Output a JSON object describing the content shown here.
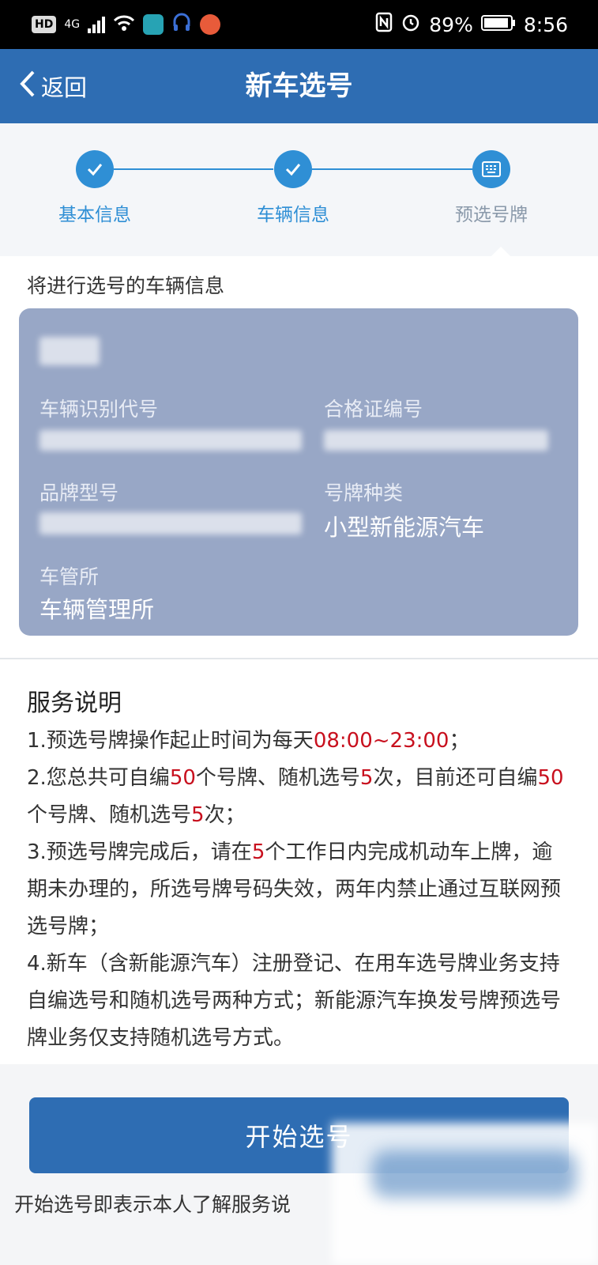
{
  "status_bar": {
    "badge": "HD",
    "network": "4G",
    "battery": "89%",
    "time": "8:56",
    "colors": {
      "app_teal": "#27a3b4",
      "app_orange": "#e85b3a",
      "app_blue": "#3b6fd6"
    }
  },
  "header": {
    "back_label": "返回",
    "title": "新车选号",
    "color": "#2e6db3"
  },
  "steps": [
    {
      "label": "基本信息",
      "state": "done",
      "icon": "check-icon"
    },
    {
      "label": "车辆信息",
      "state": "done",
      "icon": "check-icon"
    },
    {
      "label": "预选号牌",
      "state": "current",
      "icon": "keyboard-icon"
    }
  ],
  "vehicle": {
    "heading": "将进行选号的车辆信息",
    "vin_label": "车辆识别代号",
    "cert_label": "合格证编号",
    "model_label": "品牌型号",
    "plate_type_label": "号牌种类",
    "plate_type_value": "小型新能源汽车",
    "office_label": "车管所",
    "office_value": "车辆管理所"
  },
  "service": {
    "title": "服务说明",
    "item1_a": "1.预选号牌操作起止时间为每天",
    "item1_time": "08:00~23:00",
    "item1_b": "；",
    "item2_a": "2.您总共可自编",
    "item2_n1": "50",
    "item2_b": "个号牌、随机选号",
    "item2_n2": "5",
    "item2_c": "次，目前还可自编",
    "item2_n3": "50",
    "item2_d": "个号牌、随机选号",
    "item2_n4": "5",
    "item2_e": "次；",
    "item3_a": "3.预选号牌完成后，请在",
    "item3_n": "5",
    "item3_b": "个工作日内完成机动车上牌，逾期未办理的，所选号牌号码失效，两年内禁止通过互联网预选号牌；",
    "item4": "4.新车（含新能源汽车）注册登记、在用车选号牌业务支持自编选号和随机选号两种方式；新能源汽车换发号牌预选号牌业务仅支持随机选号方式。",
    "highlight_color": "#c8101e"
  },
  "start_button_label": "开始选号",
  "footer_note": "开始选号即表示本人了解服务说"
}
